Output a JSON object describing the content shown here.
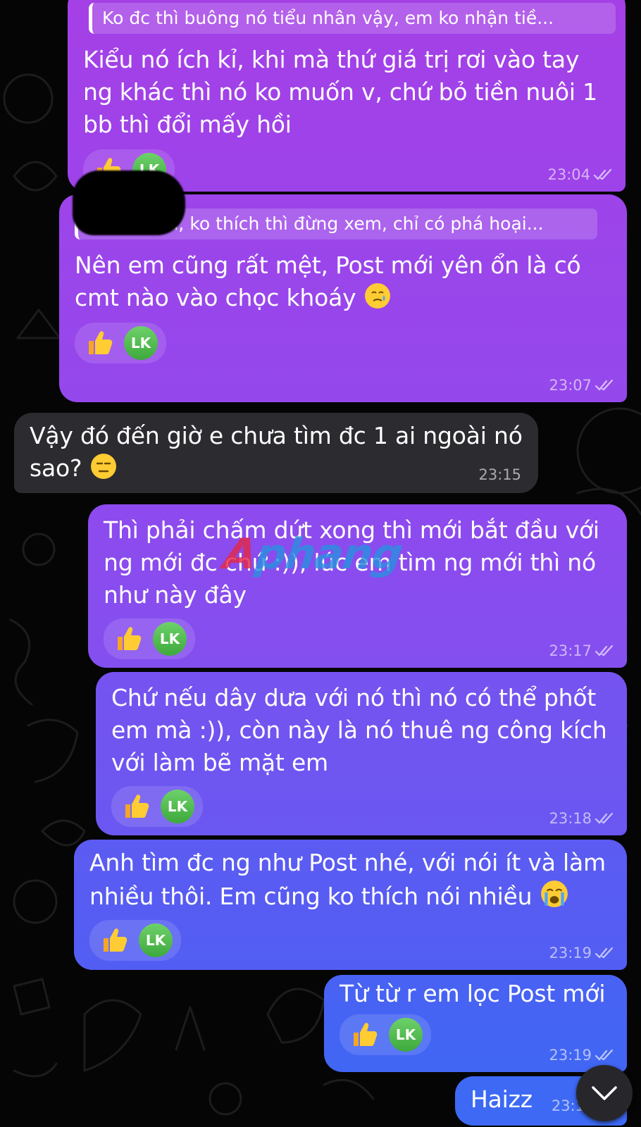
{
  "colors": {
    "background": "#050505",
    "incoming_bubble": "#2c2b30",
    "outgoing_gradient_top": "#a13fe6",
    "outgoing_gradient_bottom": "#3f63f5",
    "reaction_avatar": "#4cb84a"
  },
  "messages": [
    {
      "id": "m1",
      "direction": "outgoing",
      "reply_quote": "Ko đc thì buông nó tiểu nhân vậy, em ko nhận tiề...",
      "text": "Kiểu nó ích kỉ, khi mà thứ giá trị rơi vào tay\nng khác thì nó ko muốn v, chứ bỏ tiền nuôi 1\nbb thì đổi mấy hồi",
      "reaction_icon": "thumbs-up-icon",
      "reactor_initials": "LK",
      "time": "23:04",
      "read_status": "double-check-icon"
    },
    {
      "id": "m2",
      "direction": "outgoing",
      "reply_quote": "A thấy mà, ko thích thì đừng xem, chỉ có phá hoại...",
      "text": "Nên em cũng rất mệt, Post mới yên ổn là có\ncmt nào vào chọc khoáy",
      "emoji": "crying-smile-emoji-icon",
      "reaction_icon": "thumbs-up-icon",
      "reactor_initials": "LK",
      "time": "23:07",
      "read_status": "double-check-icon"
    },
    {
      "id": "m3",
      "direction": "incoming",
      "text": "Vậy đó đến giờ e chưa tìm đc 1 ai ngoài nó\nsao?",
      "emoji": "expressionless-face-emoji-icon",
      "time": "23:15"
    },
    {
      "id": "m4",
      "direction": "outgoing",
      "text": "Thì phải chấm dứt xong thì mới bắt đầu với\nng mới đc chứ :)), lúc em tìm ng mới thì nó\nnhư này đây",
      "reaction_icon": "thumbs-up-icon",
      "reactor_initials": "LK",
      "time": "23:17",
      "read_status": "double-check-icon"
    },
    {
      "id": "m5",
      "direction": "outgoing",
      "text": "Chứ nếu dây dưa với nó thì nó có thể phốt\nem mà :)), còn này là nó thuê ng công kích\nvới làm bẽ mặt em",
      "reaction_icon": "thumbs-up-icon",
      "reactor_initials": "LK",
      "time": "23:18",
      "read_status": "double-check-icon"
    },
    {
      "id": "m6",
      "direction": "outgoing",
      "text": "Anh tìm đc ng như Post nhé, với nói ít và làm\nnhiều thôi. Em cũng ko thích nói nhiều",
      "emoji": "loudly-crying-emoji-icon",
      "reaction_icon": "thumbs-up-icon",
      "reactor_initials": "LK",
      "time": "23:19",
      "read_status": "double-check-icon"
    },
    {
      "id": "m7",
      "direction": "outgoing",
      "text": "Từ từ r em lọc Post mới",
      "reaction_icon": "thumbs-up-icon",
      "reactor_initials": "LK",
      "time": "23:19",
      "read_status": "double-check-icon"
    },
    {
      "id": "m8",
      "direction": "outgoing",
      "text": "Haizz",
      "time": "23:1"
    }
  ],
  "watermark": {
    "first": "A",
    "rest": "phang"
  },
  "scroll_button": {
    "icon": "chevron-down-icon"
  }
}
